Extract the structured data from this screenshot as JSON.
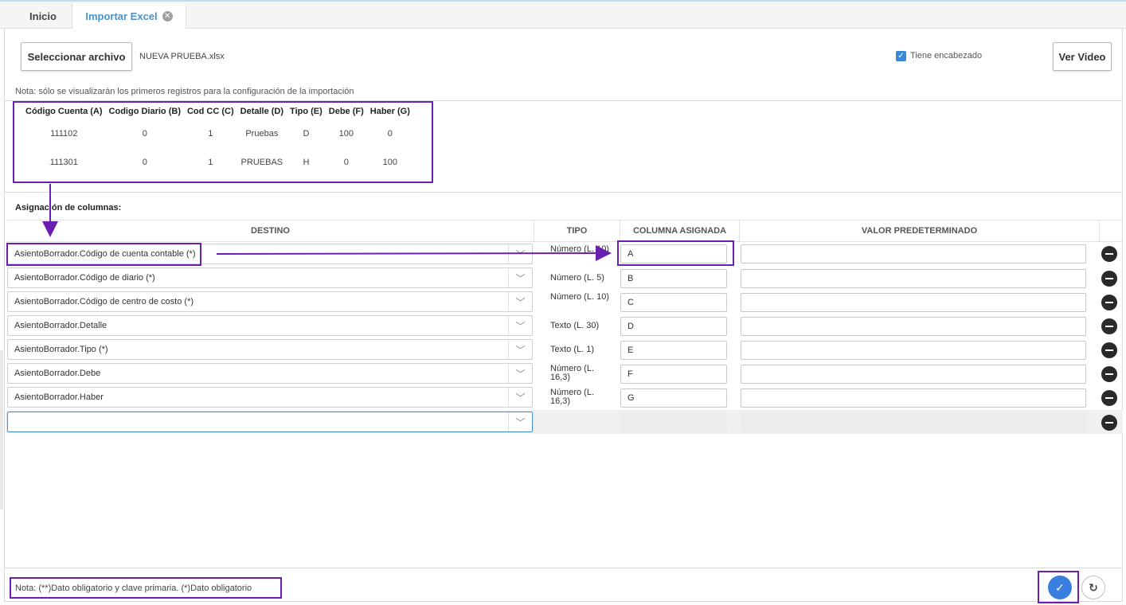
{
  "tabs": {
    "home": "Inicio",
    "active": "Importar Excel"
  },
  "toolbar": {
    "select_file": "Seleccionar archivo",
    "file_name": "NUEVA PRUEBA.xlsx",
    "has_header_label": "Tiene encabezado",
    "has_header_checked": true,
    "video_button": "Ver Video"
  },
  "note_top": "Nota: sólo se visualizarán los primeros registros para la configuración de la importación",
  "preview": {
    "headers": [
      "Código Cuenta (A)",
      "Codigo Diario (B)",
      "Cod CC (C)",
      "Detalle (D)",
      "Tipo (E)",
      "Debe (F)",
      "Haber (G)"
    ],
    "rows": [
      [
        "111102",
        "0",
        "1",
        "Pruebas",
        "D",
        "100",
        "0"
      ],
      [
        "111301",
        "0",
        "1",
        "PRUEBAS",
        "H",
        "0",
        "100"
      ]
    ]
  },
  "mapping": {
    "title": "Asignación de columnas:",
    "headers": {
      "destino": "DESTINO",
      "tipo": "TIPO",
      "columna": "COLUMNA ASIGNADA",
      "valor": "VALOR PREDETERMINADO"
    },
    "rows": [
      {
        "destino": "AsientoBorrador.Código de cuenta contable (*)",
        "tipo": "Número (L. 10)",
        "columna": "A",
        "valor": ""
      },
      {
        "destino": "AsientoBorrador.Código de diario (*)",
        "tipo": "Número (L. 5)",
        "columna": "B",
        "valor": ""
      },
      {
        "destino": "AsientoBorrador.Código de centro de costo (*)",
        "tipo": "Número (L. 10)",
        "columna": "C",
        "valor": ""
      },
      {
        "destino": "AsientoBorrador.Detalle",
        "tipo": "Texto (L. 30)",
        "columna": "D",
        "valor": ""
      },
      {
        "destino": "AsientoBorrador.Tipo (*)",
        "tipo": "Texto (L. 1)",
        "columna": "E",
        "valor": ""
      },
      {
        "destino": "AsientoBorrador.Debe",
        "tipo": "Número (L. 16,3)",
        "columna": "F",
        "valor": ""
      },
      {
        "destino": "AsientoBorrador.Haber",
        "tipo": "Número (L. 16,3)",
        "columna": "G",
        "valor": ""
      },
      {
        "destino": "",
        "tipo": "",
        "columna": "",
        "valor": ""
      }
    ]
  },
  "note_bottom": "Nota: (**)Dato obligatorio y clave primaria. (*)Dato obligatorio",
  "actions": {
    "accept_icon": "check-icon",
    "reset_icon": "refresh-icon"
  },
  "colors": {
    "accent": "#4a90c8",
    "highlight": "#6a1fb0",
    "accept": "#3a7ee0"
  }
}
